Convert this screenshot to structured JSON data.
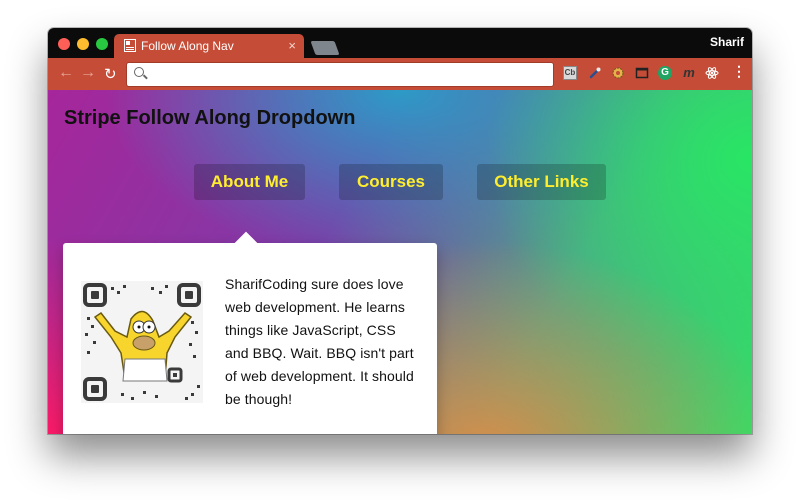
{
  "browser": {
    "tab_title": "Follow Along Nav",
    "tab_close": "×",
    "profile_name": "Sharif",
    "address_value": "",
    "nav_back": "←",
    "nav_forward": "→",
    "nav_reload": "↻",
    "extensions": {
      "cb_label": "Cb",
      "grammarly_label": "G",
      "m_label": "m",
      "menu_label": "⋮"
    }
  },
  "page": {
    "title": "Stripe Follow Along Dropdown",
    "nav_items": [
      {
        "label": "About Me"
      },
      {
        "label": "Courses"
      },
      {
        "label": "Other Links"
      }
    ],
    "dropdown": {
      "bio": "SharifCoding sure does love web development. He learns things like JavaScript, CSS and BBQ. Wait. BBQ isn't part of web development. It should be though!"
    }
  },
  "colors": {
    "tab_bar": "#c54d38",
    "nav_text": "#ffee2e"
  }
}
